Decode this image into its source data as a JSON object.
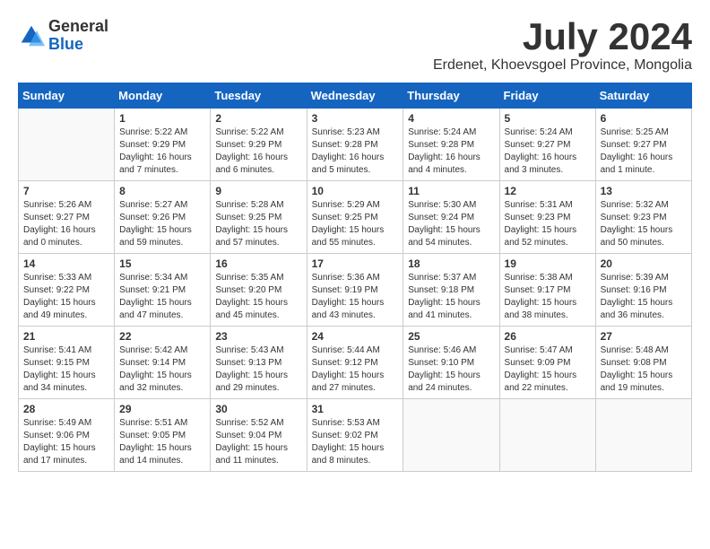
{
  "header": {
    "logo_general": "General",
    "logo_blue": "Blue",
    "month_year": "July 2024",
    "location": "Erdenet, Khoevsgoel Province, Mongolia"
  },
  "weekdays": [
    "Sunday",
    "Monday",
    "Tuesday",
    "Wednesday",
    "Thursday",
    "Friday",
    "Saturday"
  ],
  "weeks": [
    [
      {
        "day": "",
        "info": ""
      },
      {
        "day": "1",
        "info": "Sunrise: 5:22 AM\nSunset: 9:29 PM\nDaylight: 16 hours\nand 7 minutes."
      },
      {
        "day": "2",
        "info": "Sunrise: 5:22 AM\nSunset: 9:29 PM\nDaylight: 16 hours\nand 6 minutes."
      },
      {
        "day": "3",
        "info": "Sunrise: 5:23 AM\nSunset: 9:28 PM\nDaylight: 16 hours\nand 5 minutes."
      },
      {
        "day": "4",
        "info": "Sunrise: 5:24 AM\nSunset: 9:28 PM\nDaylight: 16 hours\nand 4 minutes."
      },
      {
        "day": "5",
        "info": "Sunrise: 5:24 AM\nSunset: 9:27 PM\nDaylight: 16 hours\nand 3 minutes."
      },
      {
        "day": "6",
        "info": "Sunrise: 5:25 AM\nSunset: 9:27 PM\nDaylight: 16 hours\nand 1 minute."
      }
    ],
    [
      {
        "day": "7",
        "info": "Sunrise: 5:26 AM\nSunset: 9:27 PM\nDaylight: 16 hours\nand 0 minutes."
      },
      {
        "day": "8",
        "info": "Sunrise: 5:27 AM\nSunset: 9:26 PM\nDaylight: 15 hours\nand 59 minutes."
      },
      {
        "day": "9",
        "info": "Sunrise: 5:28 AM\nSunset: 9:25 PM\nDaylight: 15 hours\nand 57 minutes."
      },
      {
        "day": "10",
        "info": "Sunrise: 5:29 AM\nSunset: 9:25 PM\nDaylight: 15 hours\nand 55 minutes."
      },
      {
        "day": "11",
        "info": "Sunrise: 5:30 AM\nSunset: 9:24 PM\nDaylight: 15 hours\nand 54 minutes."
      },
      {
        "day": "12",
        "info": "Sunrise: 5:31 AM\nSunset: 9:23 PM\nDaylight: 15 hours\nand 52 minutes."
      },
      {
        "day": "13",
        "info": "Sunrise: 5:32 AM\nSunset: 9:23 PM\nDaylight: 15 hours\nand 50 minutes."
      }
    ],
    [
      {
        "day": "14",
        "info": "Sunrise: 5:33 AM\nSunset: 9:22 PM\nDaylight: 15 hours\nand 49 minutes."
      },
      {
        "day": "15",
        "info": "Sunrise: 5:34 AM\nSunset: 9:21 PM\nDaylight: 15 hours\nand 47 minutes."
      },
      {
        "day": "16",
        "info": "Sunrise: 5:35 AM\nSunset: 9:20 PM\nDaylight: 15 hours\nand 45 minutes."
      },
      {
        "day": "17",
        "info": "Sunrise: 5:36 AM\nSunset: 9:19 PM\nDaylight: 15 hours\nand 43 minutes."
      },
      {
        "day": "18",
        "info": "Sunrise: 5:37 AM\nSunset: 9:18 PM\nDaylight: 15 hours\nand 41 minutes."
      },
      {
        "day": "19",
        "info": "Sunrise: 5:38 AM\nSunset: 9:17 PM\nDaylight: 15 hours\nand 38 minutes."
      },
      {
        "day": "20",
        "info": "Sunrise: 5:39 AM\nSunset: 9:16 PM\nDaylight: 15 hours\nand 36 minutes."
      }
    ],
    [
      {
        "day": "21",
        "info": "Sunrise: 5:41 AM\nSunset: 9:15 PM\nDaylight: 15 hours\nand 34 minutes."
      },
      {
        "day": "22",
        "info": "Sunrise: 5:42 AM\nSunset: 9:14 PM\nDaylight: 15 hours\nand 32 minutes."
      },
      {
        "day": "23",
        "info": "Sunrise: 5:43 AM\nSunset: 9:13 PM\nDaylight: 15 hours\nand 29 minutes."
      },
      {
        "day": "24",
        "info": "Sunrise: 5:44 AM\nSunset: 9:12 PM\nDaylight: 15 hours\nand 27 minutes."
      },
      {
        "day": "25",
        "info": "Sunrise: 5:46 AM\nSunset: 9:10 PM\nDaylight: 15 hours\nand 24 minutes."
      },
      {
        "day": "26",
        "info": "Sunrise: 5:47 AM\nSunset: 9:09 PM\nDaylight: 15 hours\nand 22 minutes."
      },
      {
        "day": "27",
        "info": "Sunrise: 5:48 AM\nSunset: 9:08 PM\nDaylight: 15 hours\nand 19 minutes."
      }
    ],
    [
      {
        "day": "28",
        "info": "Sunrise: 5:49 AM\nSunset: 9:06 PM\nDaylight: 15 hours\nand 17 minutes."
      },
      {
        "day": "29",
        "info": "Sunrise: 5:51 AM\nSunset: 9:05 PM\nDaylight: 15 hours\nand 14 minutes."
      },
      {
        "day": "30",
        "info": "Sunrise: 5:52 AM\nSunset: 9:04 PM\nDaylight: 15 hours\nand 11 minutes."
      },
      {
        "day": "31",
        "info": "Sunrise: 5:53 AM\nSunset: 9:02 PM\nDaylight: 15 hours\nand 8 minutes."
      },
      {
        "day": "",
        "info": ""
      },
      {
        "day": "",
        "info": ""
      },
      {
        "day": "",
        "info": ""
      }
    ]
  ]
}
